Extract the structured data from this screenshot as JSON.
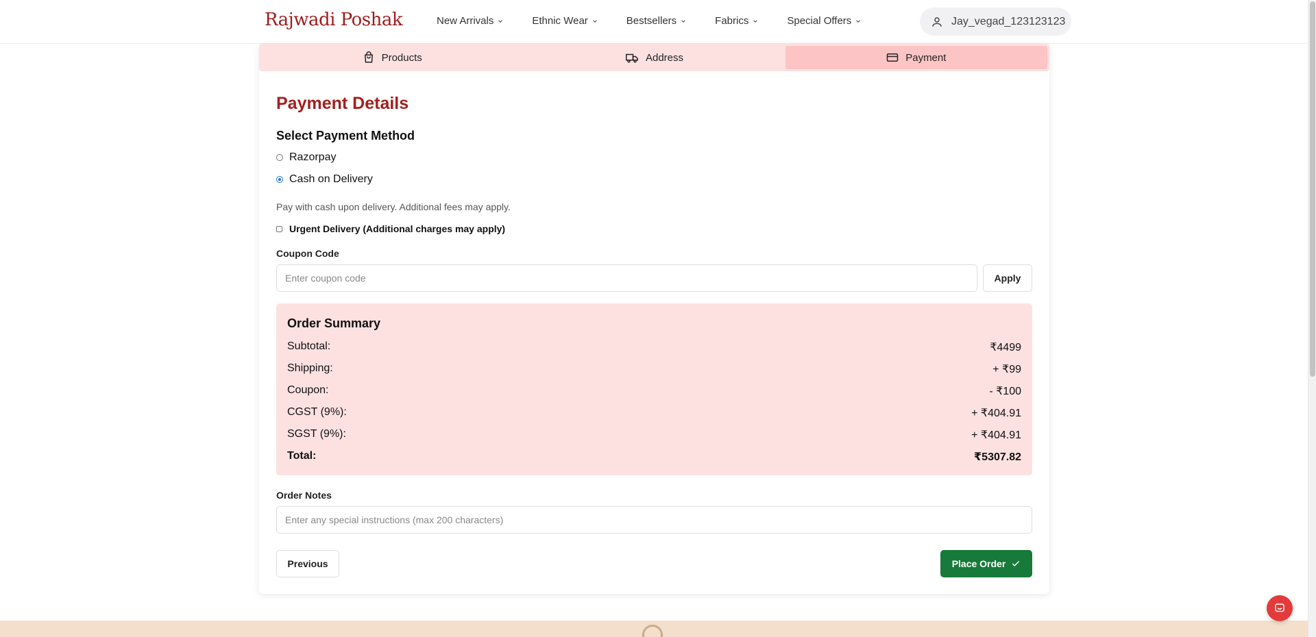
{
  "brand": {
    "logo_text": "Rajwadi Poshak",
    "logo_color": "#9e1c1c"
  },
  "nav": {
    "items": [
      {
        "label": "New Arrivals"
      },
      {
        "label": "Ethnic Wear"
      },
      {
        "label": "Bestsellers"
      },
      {
        "label": "Fabrics"
      },
      {
        "label": "Special Offers"
      }
    ],
    "user": {
      "name": "Jay_vegad_123123123",
      "icon": "user-icon"
    }
  },
  "steps": [
    {
      "label": "Products",
      "icon": "shopping-bag-icon",
      "active": false
    },
    {
      "label": "Address",
      "icon": "truck-icon",
      "active": false
    },
    {
      "label": "Payment",
      "icon": "credit-card-icon",
      "active": true
    }
  ],
  "payment": {
    "title": "Payment Details",
    "method_heading": "Select Payment Method",
    "methods": [
      {
        "label": "Razorpay",
        "selected": false
      },
      {
        "label": "Cash on Delivery",
        "selected": true
      }
    ],
    "hint": "Pay with cash upon delivery. Additional fees may apply.",
    "urgent_label": "Urgent Delivery (Additional charges may apply)",
    "urgent_checked": false,
    "coupon_label": "Coupon Code",
    "coupon_placeholder": "Enter coupon code",
    "coupon_value": "",
    "apply_label": "Apply"
  },
  "summary": {
    "heading": "Order Summary",
    "rows": [
      {
        "label": "Subtotal:",
        "value": "₹4499"
      },
      {
        "label": "Shipping:",
        "value": "+ ₹99"
      },
      {
        "label": "Coupon:",
        "value": "- ₹100"
      },
      {
        "label": "CGST (9%):",
        "value": "+ ₹404.91"
      },
      {
        "label": "SGST (9%):",
        "value": "+ ₹404.91"
      }
    ],
    "total_label": "Total:",
    "total_value": "₹5307.82",
    "bg_color": "#fde1e1"
  },
  "notes": {
    "label": "Order Notes",
    "placeholder": "Enter any special instructions (max 200 characters)",
    "value": ""
  },
  "actions": {
    "previous_label": "Previous",
    "place_order_label": "Place Order",
    "place_order_color": "#177a3a"
  },
  "colors": {
    "accent": "#a31f1f",
    "step_bg": "#fde1e1",
    "step_active": "#fcc4c4",
    "chat": "#e33b3b"
  }
}
